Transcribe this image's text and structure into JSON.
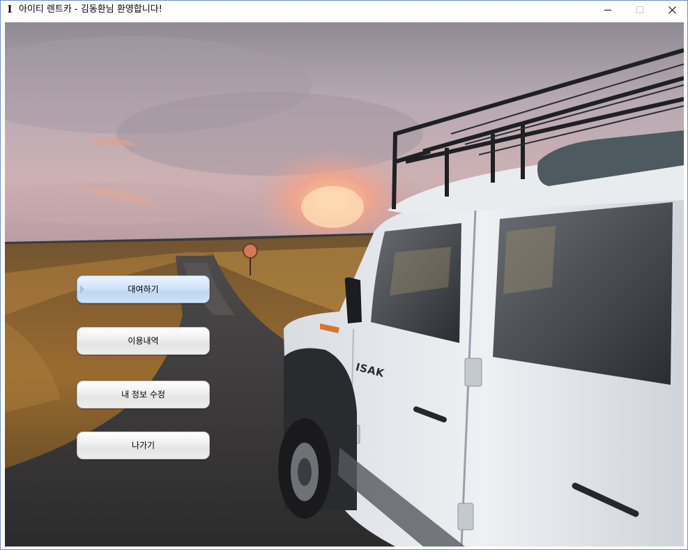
{
  "window": {
    "title": "아이티 렌트카 - 김동환님 환영합니다!",
    "app_icon_glyph": "I",
    "controls": {
      "minimize_icon": "minimize-icon",
      "maximize_icon": "maximize-icon",
      "close_icon": "close-icon"
    }
  },
  "background": {
    "image_description_icon": "photo-white-jeep-on-gravel-road-at-sunset",
    "vehicle_badge_text": "ISAK"
  },
  "menu": {
    "items": [
      {
        "label": "대여하기",
        "state": "hover"
      },
      {
        "label": "이용내역",
        "state": "normal"
      },
      {
        "label": "내 정보 수정",
        "state": "normal"
      },
      {
        "label": "나가기",
        "state": "normal"
      }
    ]
  },
  "colors": {
    "window_border": "#6b8fbf",
    "button_active": "#c9dcf3",
    "button_normal": "#ececec"
  }
}
